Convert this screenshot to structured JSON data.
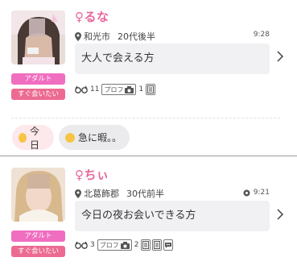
{
  "cards": [
    {
      "name": "るな",
      "gender_symbol": "♀",
      "location": "和光市",
      "age": "20代後半",
      "time": "9:28",
      "message": "大人で会える方",
      "tags": [
        "アダルト",
        "すぐ会いたい"
      ],
      "stats": {
        "glasses_count": "11",
        "profile_label": "プロフ",
        "photo_count": "1"
      }
    },
    {
      "name": "ちぃ",
      "gender_symbol": "♀",
      "location": "北葛飾郡",
      "age": "30代前半",
      "time": "9:21",
      "message": "今日の夜お会いできる方",
      "tags": [
        "アダルト",
        "すぐ会いたい"
      ],
      "stats": {
        "glasses_count": "3",
        "profile_label": "プロフ",
        "photo_count": "2"
      }
    }
  ],
  "status_pills": [
    "今日",
    "急に暇。。"
  ],
  "colors": {
    "name": "#e9659c",
    "tag_adult": "#f06ec0",
    "tag_soon": "#ec6b92",
    "message_bg": "#f1f1f3"
  }
}
